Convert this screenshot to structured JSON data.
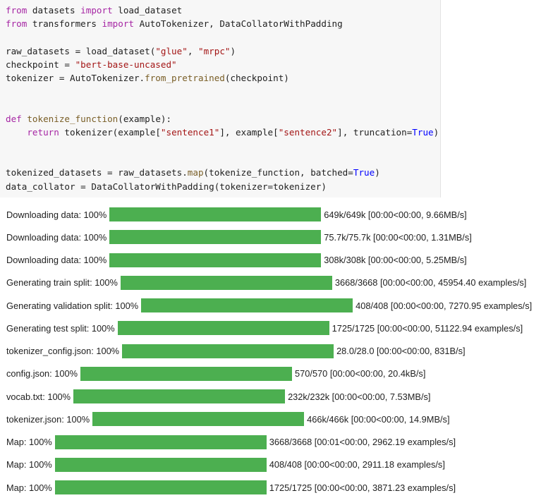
{
  "code_lines": [
    [
      {
        "t": "from",
        "c": "kw"
      },
      {
        "t": " datasets "
      },
      {
        "t": "import",
        "c": "kw"
      },
      {
        "t": " load_dataset"
      }
    ],
    [
      {
        "t": "from",
        "c": "kw"
      },
      {
        "t": " transformers "
      },
      {
        "t": "import",
        "c": "kw"
      },
      {
        "t": " AutoTokenizer, DataCollatorWithPadding"
      }
    ],
    [],
    [
      {
        "t": "raw_datasets = load_dataset("
      },
      {
        "t": "\"glue\"",
        "c": "str"
      },
      {
        "t": ", "
      },
      {
        "t": "\"mrpc\"",
        "c": "str"
      },
      {
        "t": ")"
      }
    ],
    [
      {
        "t": "checkpoint = "
      },
      {
        "t": "\"bert-base-uncased\"",
        "c": "str"
      }
    ],
    [
      {
        "t": "tokenizer = AutoTokenizer."
      },
      {
        "t": "from_pretrained",
        "c": "fn"
      },
      {
        "t": "(checkpoint)"
      }
    ],
    [],
    [],
    [
      {
        "t": "def",
        "c": "kw"
      },
      {
        "t": " "
      },
      {
        "t": "tokenize_function",
        "c": "fn"
      },
      {
        "t": "(example):"
      }
    ],
    [
      {
        "t": "    "
      },
      {
        "t": "return",
        "c": "kw"
      },
      {
        "t": " tokenizer(example["
      },
      {
        "t": "\"sentence1\"",
        "c": "str"
      },
      {
        "t": "], example["
      },
      {
        "t": "\"sentence2\"",
        "c": "str"
      },
      {
        "t": "], truncation="
      },
      {
        "t": "True",
        "c": "kb"
      },
      {
        "t": ")"
      }
    ],
    [],
    [],
    [
      {
        "t": "tokenized_datasets = raw_datasets."
      },
      {
        "t": "map",
        "c": "fn"
      },
      {
        "t": "(tokenize_function, batched="
      },
      {
        "t": "True",
        "c": "kb"
      },
      {
        "t": ")"
      }
    ],
    [
      {
        "t": "data_collator = DataCollatorWithPadding(tokenizer=tokenizer)"
      }
    ]
  ],
  "progress_rows": [
    {
      "label": "Downloading data: 100%",
      "progress": 1.0,
      "stats": "649k/649k [00:00<00:00, 9.66MB/s]"
    },
    {
      "label": "Downloading data: 100%",
      "progress": 1.0,
      "stats": "75.7k/75.7k [00:00<00:00, 1.31MB/s]"
    },
    {
      "label": "Downloading data: 100%",
      "progress": 1.0,
      "stats": "308k/308k [00:00<00:00, 5.25MB/s]"
    },
    {
      "label": "Generating train split: 100%",
      "progress": 1.0,
      "stats": "3668/3668 [00:00<00:00, 45954.40 examples/s]"
    },
    {
      "label": "Generating validation split: 100%",
      "progress": 1.0,
      "stats": "408/408 [00:00<00:00, 7270.95 examples/s]"
    },
    {
      "label": "Generating test split: 100%",
      "progress": 1.0,
      "stats": "1725/1725 [00:00<00:00, 51122.94 examples/s]"
    },
    {
      "label": "tokenizer_config.json: 100%",
      "progress": 1.0,
      "stats": "28.0/28.0 [00:00<00:00, 831B/s]"
    },
    {
      "label": "config.json: 100%",
      "progress": 1.0,
      "stats": "570/570 [00:00<00:00, 20.4kB/s]"
    },
    {
      "label": "vocab.txt: 100%",
      "progress": 1.0,
      "stats": "232k/232k [00:00<00:00, 7.53MB/s]"
    },
    {
      "label": "tokenizer.json: 100%",
      "progress": 1.0,
      "stats": "466k/466k [00:00<00:00, 14.9MB/s]"
    },
    {
      "label": "Map: 100%",
      "progress": 1.0,
      "stats": "3668/3668 [00:01<00:00, 2962.19 examples/s]"
    },
    {
      "label": "Map: 100%",
      "progress": 1.0,
      "stats": "408/408 [00:00<00:00, 2911.18 examples/s]"
    },
    {
      "label": "Map: 100%",
      "progress": 1.0,
      "stats": "1725/1725 [00:00<00:00, 3871.23 examples/s]"
    }
  ],
  "colors": {
    "progress_fill": "#4caf50",
    "code_background": "#f7f7f7",
    "keyword": "#a626a4",
    "string": "#a31515",
    "function": "#795e26",
    "constant": "#0000ff"
  }
}
